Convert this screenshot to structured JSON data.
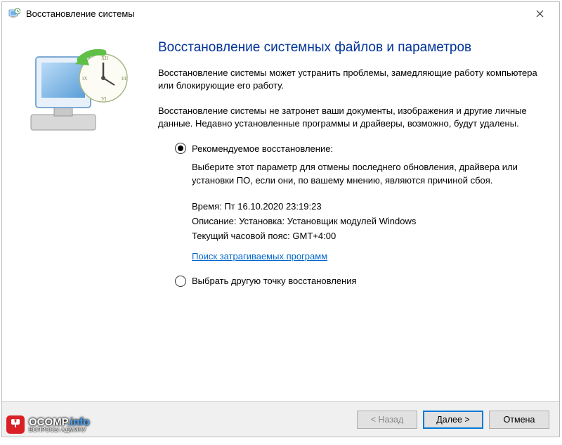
{
  "titlebar": {
    "text": "Восстановление системы"
  },
  "content": {
    "heading": "Восстановление системных файлов и параметров",
    "para1": "Восстановление системы может устранить проблемы, замедляющие работу компьютера или блокирующие его работу.",
    "para2": "Восстановление системы не затронет ваши документы, изображения и другие личные данные. Недавно установленные программы и драйверы, возможно, будут удалены."
  },
  "options": {
    "recommended": {
      "label": "Рекомендуемое восстановление:",
      "desc": "Выберите этот параметр для отмены последнего обновления, драйвера или установки ПО, если они, по вашему мнению, являются причиной сбоя.",
      "time_label": "Время:",
      "time_value": "Пт 16.10.2020 23:19:23",
      "desc_label": "Описание:",
      "desc_value": "Установка: Установщик модулей Windows",
      "tz_label": "Текущий часовой пояс:",
      "tz_value": "GMT+4:00",
      "link": "Поиск затрагиваемых программ"
    },
    "other": {
      "label": "Выбрать другую точку восстановления"
    }
  },
  "footer": {
    "back": "< Назад",
    "next": "Далее >",
    "cancel": "Отмена"
  },
  "watermark": {
    "brand": "OCOMP",
    "domain": ".info",
    "sub": "ВОПРОСЫ АДМИНУ"
  }
}
